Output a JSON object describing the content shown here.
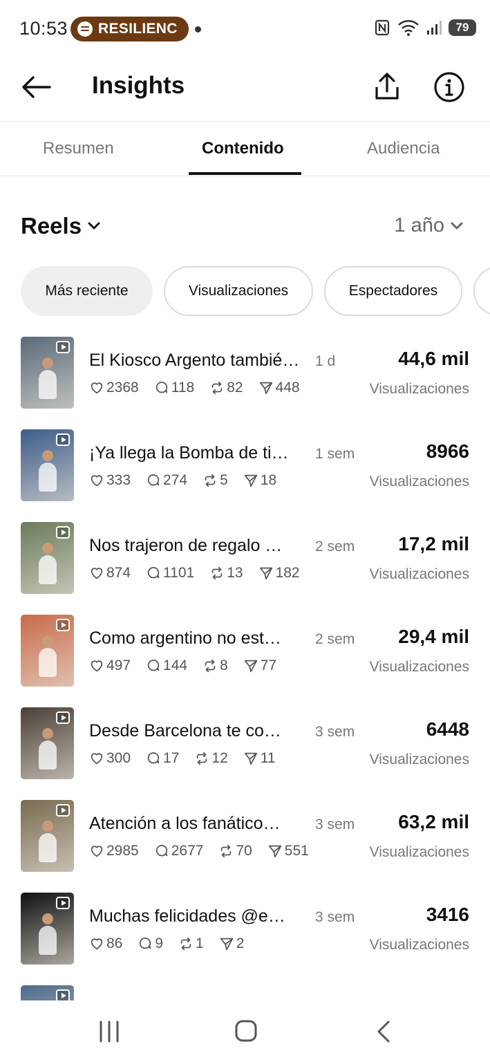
{
  "status_bar": {
    "time": "10:53",
    "media_label": "RESILIENC",
    "battery": "79"
  },
  "header": {
    "title": "Insights"
  },
  "tabs": [
    {
      "label": "Resumen",
      "active": false
    },
    {
      "label": "Contenido",
      "active": true
    },
    {
      "label": "Audiencia",
      "active": false
    }
  ],
  "filters": {
    "content_type": "Reels",
    "period": "1 año"
  },
  "sort_chips": [
    {
      "label": "Más reciente",
      "active": true
    },
    {
      "label": "Visualizaciones",
      "active": false
    },
    {
      "label": "Espectadores",
      "active": false
    }
  ],
  "reels": [
    {
      "caption": "El Kiosco Argento tambié…",
      "age": "1 d",
      "likes": "2368",
      "comments": "118",
      "reposts": "82",
      "shares": "448",
      "value": "44,6 mil",
      "metric": "Visualizaciones"
    },
    {
      "caption": "¡Ya llega la Bomba de ti…",
      "age": "1 sem",
      "likes": "333",
      "comments": "274",
      "reposts": "5",
      "shares": "18",
      "value": "8966",
      "metric": "Visualizaciones"
    },
    {
      "caption": "Nos trajeron de regalo …",
      "age": "2 sem",
      "likes": "874",
      "comments": "1101",
      "reposts": "13",
      "shares": "182",
      "value": "17,2 mil",
      "metric": "Visualizaciones"
    },
    {
      "caption": "Como argentino no est…",
      "age": "2 sem",
      "likes": "497",
      "comments": "144",
      "reposts": "8",
      "shares": "77",
      "value": "29,4 mil",
      "metric": "Visualizaciones"
    },
    {
      "caption": "Desde Barcelona te co…",
      "age": "3 sem",
      "likes": "300",
      "comments": "17",
      "reposts": "12",
      "shares": "11",
      "value": "6448",
      "metric": "Visualizaciones"
    },
    {
      "caption": "Atención a los fanático…",
      "age": "3 sem",
      "likes": "2985",
      "comments": "2677",
      "reposts": "70",
      "shares": "551",
      "value": "63,2 mil",
      "metric": "Visualizaciones"
    },
    {
      "caption": "Muchas felicidades @e…",
      "age": "3 sem",
      "likes": "86",
      "comments": "9",
      "reposts": "1",
      "shares": "2",
      "value": "3416",
      "metric": "Visualizaciones"
    }
  ],
  "colors": {
    "media_pill": "#6b3a12",
    "active_chip": "#efefef",
    "text_primary": "#111111",
    "text_secondary": "#777777"
  },
  "thumbnails": [
    "#5a6a7a",
    "#3d5c8a",
    "#6b7b5a",
    "#c96b4a",
    "#4a4038",
    "#7a6a50",
    "#101010",
    "#4e6a8a"
  ]
}
